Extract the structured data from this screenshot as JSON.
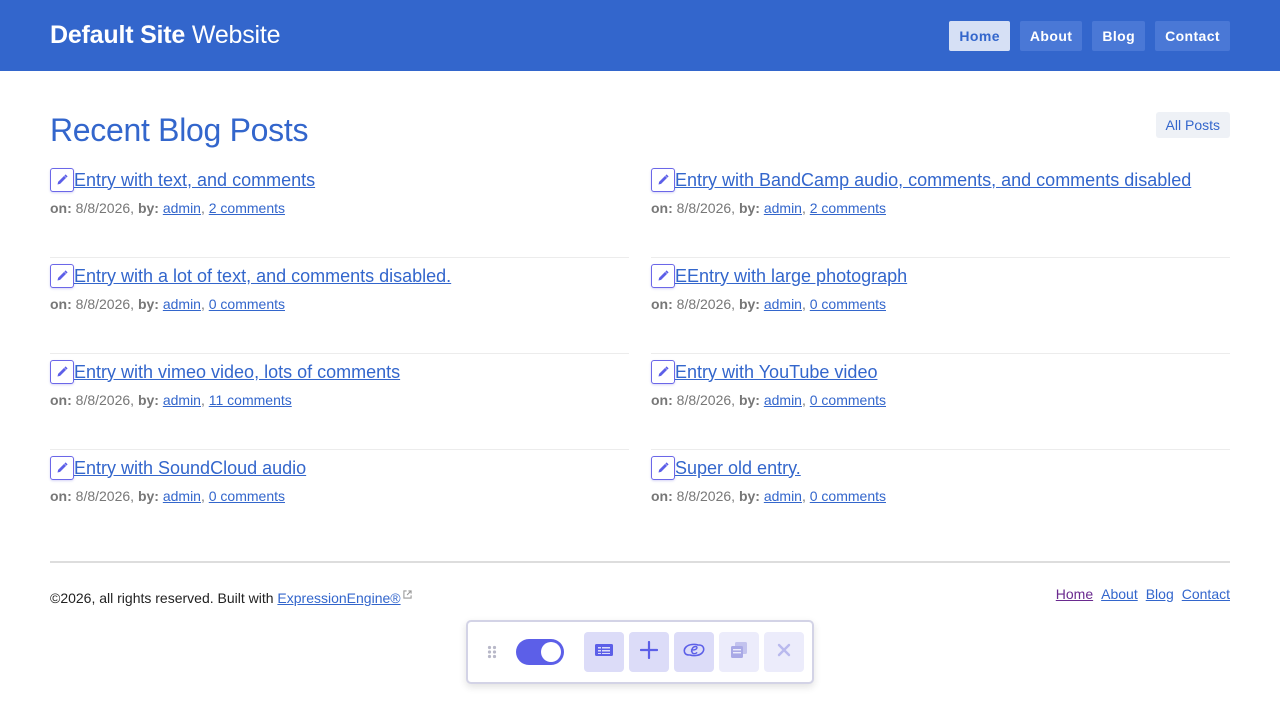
{
  "header": {
    "brand_strong": "Default Site",
    "brand_rest": "Website",
    "nav": [
      "Home",
      "About",
      "Blog",
      "Contact"
    ]
  },
  "main": {
    "title": "Recent Blog Posts",
    "all_posts": "All Posts",
    "meta_on_label": "on:",
    "meta_by_label": "by:",
    "posts": [
      {
        "title": "Entry with text, and comments",
        "date": "8/8/2026",
        "author": "admin",
        "comments": "2 comments"
      },
      {
        "title": "Entry with BandCamp audio, comments, and comments disabled",
        "date": "8/8/2026",
        "author": "admin",
        "comments": "2 comments"
      },
      {
        "title": "Entry with a lot of text, and comments disabled.",
        "date": "8/8/2026",
        "author": "admin",
        "comments": "0 comments"
      },
      {
        "title": "EEntry with large photograph",
        "date": "8/8/2026",
        "author": "admin",
        "comments": "0 comments"
      },
      {
        "title": "Entry with vimeo video, lots of comments",
        "date": "8/8/2026",
        "author": "admin",
        "comments": "11 comments"
      },
      {
        "title": "Entry with YouTube video",
        "date": "8/8/2026",
        "author": "admin",
        "comments": "0 comments"
      },
      {
        "title": "Entry with SoundCloud audio",
        "date": "8/8/2026",
        "author": "admin",
        "comments": "0 comments"
      },
      {
        "title": "Super old entry.",
        "date": "8/8/2026",
        "author": "admin",
        "comments": "0 comments"
      }
    ]
  },
  "footer": {
    "copyright": "©2026, all rights reserved. Built with",
    "ee_link": "ExpressionEngine®",
    "nav": [
      "Home",
      "About",
      "Blog",
      "Contact"
    ]
  },
  "toolbar": {
    "toggle_on": true,
    "icons": [
      "drag-handle-icon",
      "entries-icon",
      "add-icon",
      "expressionengine-logo-icon",
      "copy-icon",
      "close-icon"
    ]
  },
  "colors": {
    "primary": "#3366cc",
    "header_bg": "#3366cc",
    "toolbar_accent": "#5c5fe8"
  }
}
